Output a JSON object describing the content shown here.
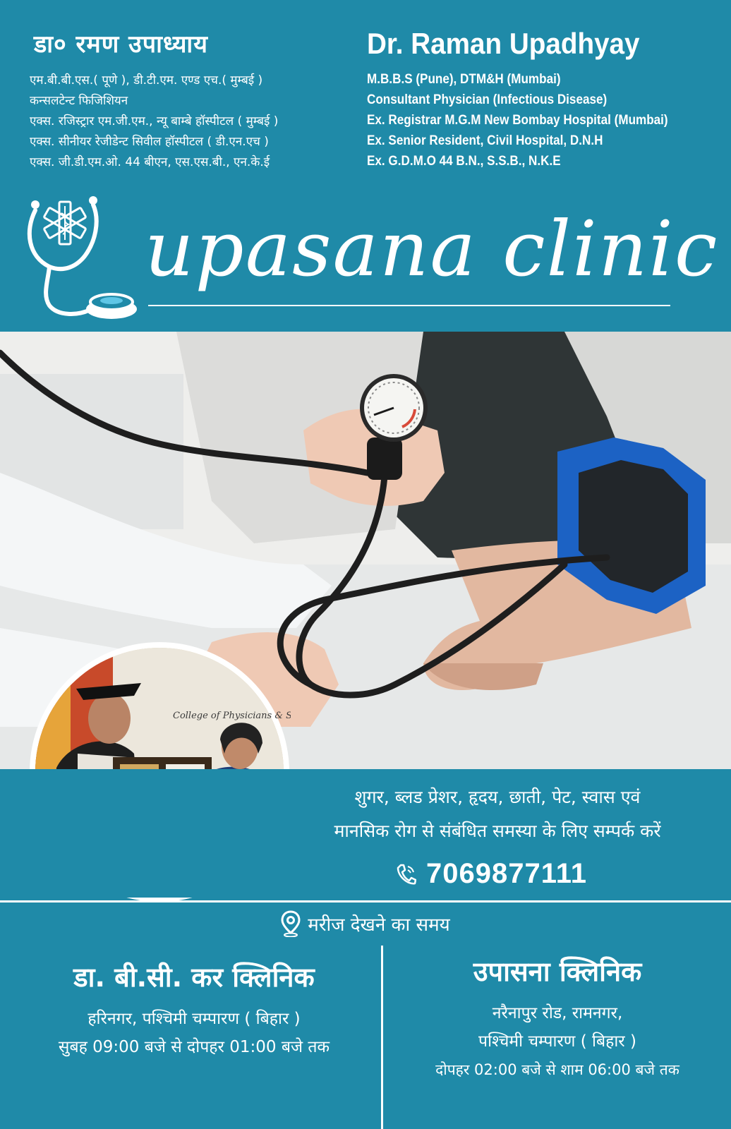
{
  "doctor": {
    "name_hi": "डा० रमण उपाध्याय",
    "lines_hi": [
      "एम.बी.बी.एस.( पूणे ), डी.टी.एम. एण्ड एच.( मुम्बई )",
      "कन्सलटेन्ट फिजिशियन",
      "एक्स. रजिस्ट्रार एम.जी.एम., न्यू बाम्बे हॉस्पीटल ( मुम्बई )",
      "एक्स. सीनीयर रेजीडेन्ट सिवील हॉस्पीटल ( डी.एन.एच )",
      "एक्स. जी.डी.एम.ओ. 44 बीएन, एस.एस.बी., एन.के.ई"
    ],
    "name_en": "Dr. Raman Upadhyay",
    "lines_en": [
      "M.B.B.S (Pune), DTM&H (Mumbai)",
      "Consultant Physician (Infectious Disease)",
      "Ex. Registrar M.G.M New Bombay Hospital (Mumbai)",
      "Ex. Senior Resident, Civil Hospital, D.N.H",
      "Ex. G.D.M.O 44 B.N., S.S.B., N.K.E"
    ]
  },
  "brand": {
    "name": "upasana clinic"
  },
  "photo": {
    "gauge_icon": "blood-pressure-gauge-icon",
    "inset_banner": "College of Physicians & Surgeons"
  },
  "services": {
    "line1": "शुगर, ब्लड प्रेशर, हृदय, छाती, पेट, स्वास एवं",
    "line2": "मानसिक रोग से संबंधित समस्या के लिए सम्पर्क करें",
    "phone": "7069877111",
    "phone_icon": "phone-icon"
  },
  "timings": {
    "heading": "मरीज देखने का समय",
    "heading_icon": "location-pin-icon",
    "clinics": [
      {
        "name": "डा. बी.सी. कर क्लिनिक",
        "address": [
          "हरिनगर, पश्चिमी चम्पारण ( बिहार )"
        ],
        "hours": "सुबह 09:00 बजे से दोपहर 01:00 बजे तक"
      },
      {
        "name": "उपासना क्लिनिक",
        "address": [
          "नरैनापुर रोड, रामनगर,",
          "पश्चिमी चम्पारण ( बिहार )"
        ],
        "hours": "दोपहर 02:00 बजे से शाम 06:00 बजे तक"
      }
    ]
  },
  "colors": {
    "primary": "#1f8aa8",
    "text": "#ffffff",
    "cuff": "#1c62c4"
  }
}
